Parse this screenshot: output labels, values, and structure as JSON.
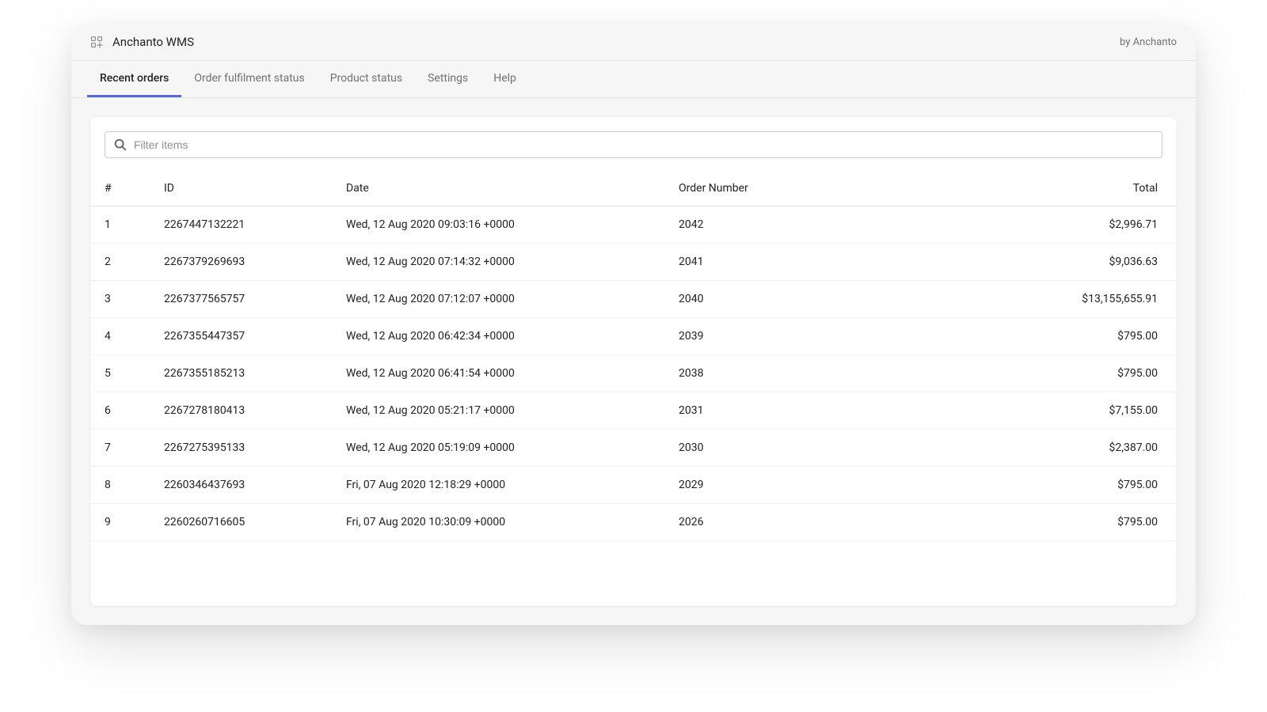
{
  "header": {
    "app_title": "Anchanto WMS",
    "by_line": "by Anchanto"
  },
  "tabs": [
    {
      "label": "Recent orders",
      "active": true
    },
    {
      "label": "Order fulfilment status",
      "active": false
    },
    {
      "label": "Product status",
      "active": false
    },
    {
      "label": "Settings",
      "active": false
    },
    {
      "label": "Help",
      "active": false
    }
  ],
  "filter": {
    "placeholder": "Filter items",
    "value": ""
  },
  "table": {
    "columns": {
      "num": "#",
      "id": "ID",
      "date": "Date",
      "order_number": "Order Number",
      "total": "Total"
    },
    "rows": [
      {
        "num": "1",
        "id": "2267447132221",
        "date": "Wed, 12 Aug 2020 09:03:16 +0000",
        "order_number": "2042",
        "total": "$2,996.71"
      },
      {
        "num": "2",
        "id": "2267379269693",
        "date": "Wed, 12 Aug 2020 07:14:32 +0000",
        "order_number": "2041",
        "total": "$9,036.63"
      },
      {
        "num": "3",
        "id": "2267377565757",
        "date": "Wed, 12 Aug 2020 07:12:07 +0000",
        "order_number": "2040",
        "total": "$13,155,655.91"
      },
      {
        "num": "4",
        "id": "2267355447357",
        "date": "Wed, 12 Aug 2020 06:42:34 +0000",
        "order_number": "2039",
        "total": "$795.00"
      },
      {
        "num": "5",
        "id": "2267355185213",
        "date": "Wed, 12 Aug 2020 06:41:54 +0000",
        "order_number": "2038",
        "total": "$795.00"
      },
      {
        "num": "6",
        "id": "2267278180413",
        "date": "Wed, 12 Aug 2020 05:21:17 +0000",
        "order_number": "2031",
        "total": "$7,155.00"
      },
      {
        "num": "7",
        "id": "2267275395133",
        "date": "Wed, 12 Aug 2020 05:19:09 +0000",
        "order_number": "2030",
        "total": "$2,387.00"
      },
      {
        "num": "8",
        "id": "2260346437693",
        "date": "Fri, 07 Aug 2020 12:18:29 +0000",
        "order_number": "2029",
        "total": "$795.00"
      },
      {
        "num": "9",
        "id": "2260260716605",
        "date": "Fri, 07 Aug 2020 10:30:09 +0000",
        "order_number": "2026",
        "total": "$795.00"
      }
    ]
  }
}
